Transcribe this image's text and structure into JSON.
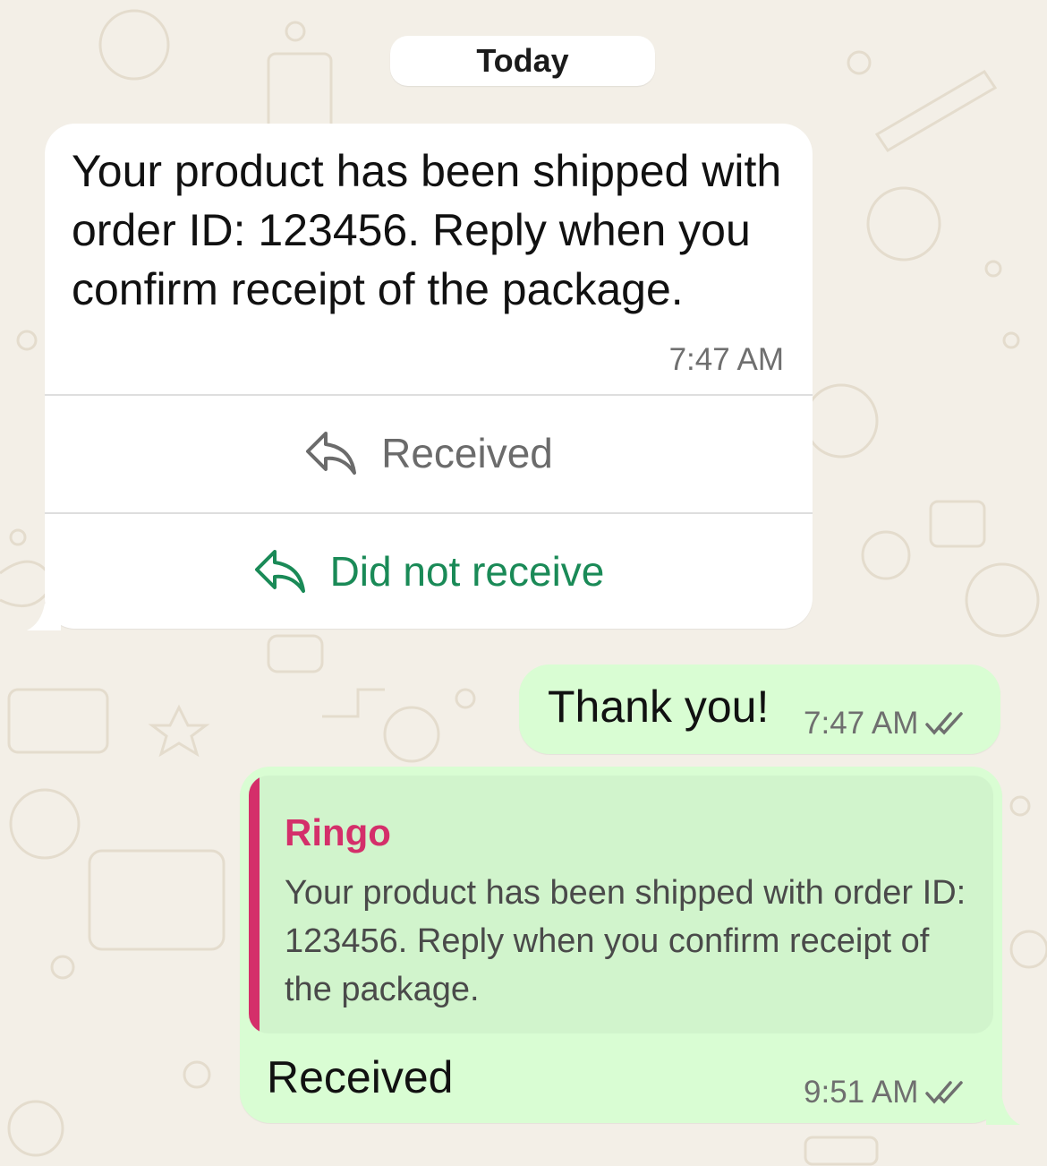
{
  "date_chip": "Today",
  "incoming": {
    "text": "Your product has been shipped with order ID: 123456. Reply when you confirm receipt of the package.",
    "time": "7:47 AM",
    "buttons": [
      {
        "label": "Received",
        "icon": "reply-icon"
      },
      {
        "label": "Did not receive",
        "icon": "reply-icon"
      }
    ]
  },
  "outgoing": [
    {
      "text": "Thank you!",
      "time": "7:47 AM",
      "status_icon": "double-check-icon"
    },
    {
      "quoted": {
        "author": "Ringo",
        "text": "Your product has been shipped with order ID: 123456. Reply when you confirm receipt of the package."
      },
      "text": "Received",
      "time": "9:51 AM",
      "status_icon": "double-check-icon"
    }
  ],
  "colors": {
    "wallpaper": "#f3efe7",
    "outgoing_bubble": "#d9fdd3",
    "quote_background": "#d1f4cc",
    "quote_accent": "#d42f6a",
    "action_green": "#1a8a57"
  }
}
